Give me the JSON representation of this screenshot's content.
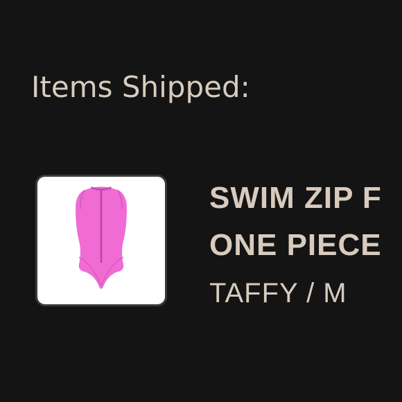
{
  "section": {
    "heading": "Items Shipped:"
  },
  "item": {
    "name_line_1": "SWIM ZIP F",
    "name_line_2": "ONE PIECE",
    "variant": "TAFFY / M",
    "image": {
      "subject": "pink sleeveless zip-front one-piece swimsuit",
      "garment_color": "#f06bd3"
    }
  }
}
